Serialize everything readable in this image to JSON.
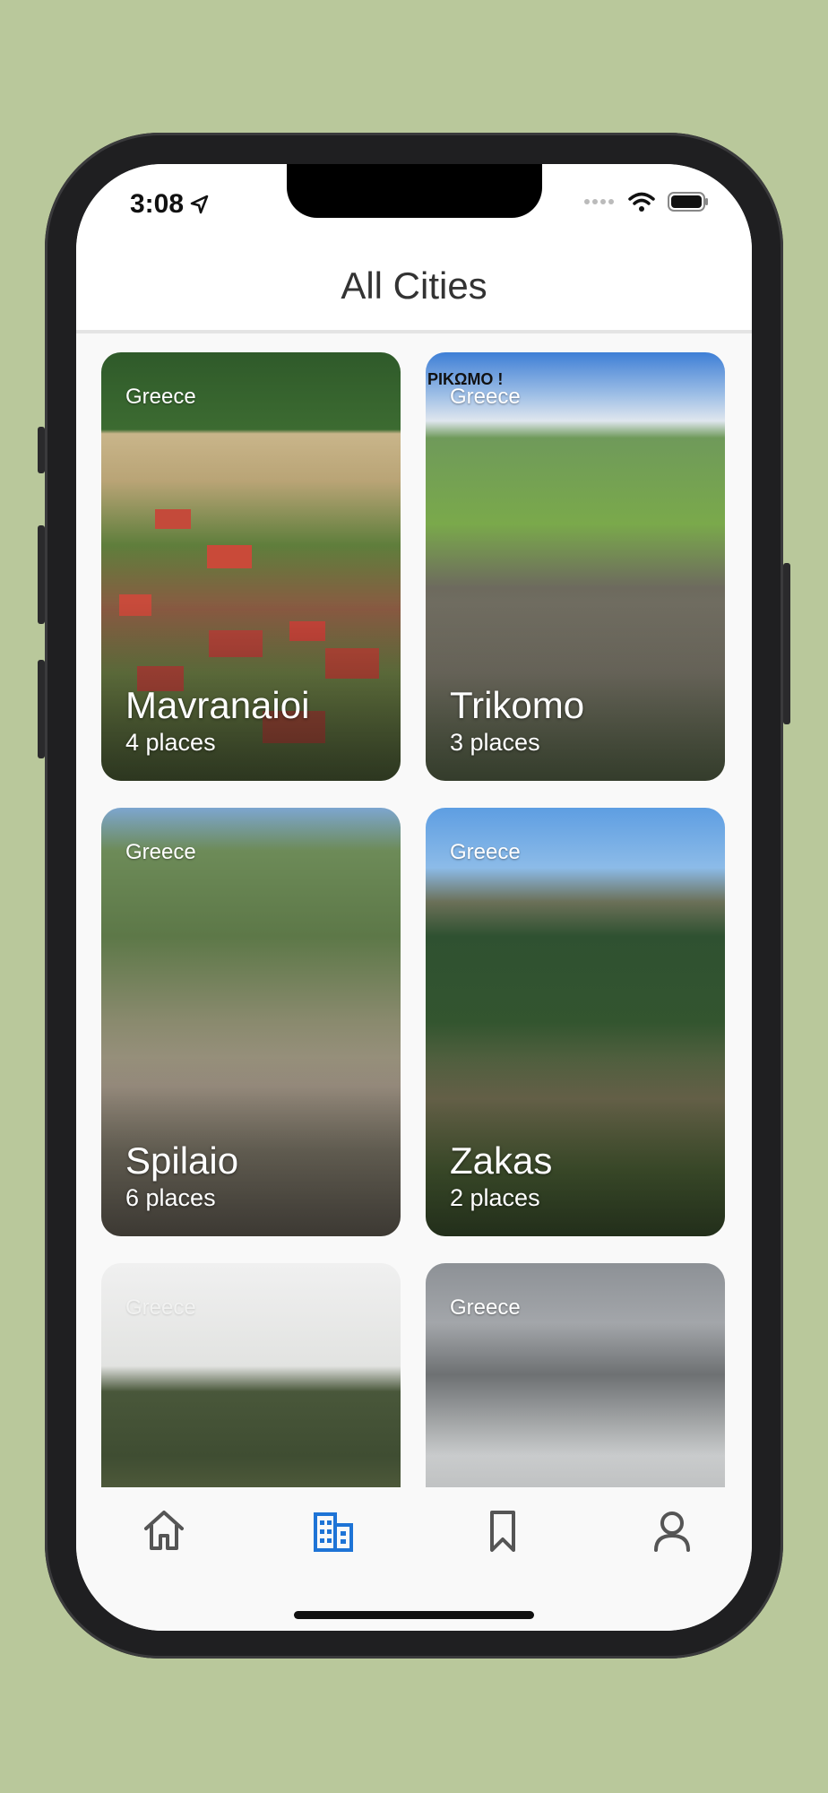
{
  "status": {
    "time": "3:08"
  },
  "header": {
    "title": "All Cities"
  },
  "cards": [
    {
      "country": "Greece",
      "name": "Mavranaioi",
      "places": "4 places"
    },
    {
      "country": "Greece",
      "name": "Trikomo",
      "places": "3 places",
      "sign": "ΡΙΚΩΜΟ !"
    },
    {
      "country": "Greece",
      "name": "Spilaio",
      "places": "6 places"
    },
    {
      "country": "Greece",
      "name": "Zakas",
      "places": "2 places"
    },
    {
      "country": "Greece",
      "name": "",
      "places": ""
    },
    {
      "country": "Greece",
      "name": "",
      "places": ""
    }
  ],
  "tabs": [
    {
      "icon": "home-icon"
    },
    {
      "icon": "city-buildings-icon",
      "active": true
    },
    {
      "icon": "bookmark-icon"
    },
    {
      "icon": "profile-icon"
    }
  ],
  "colors": {
    "background": "#b9c89b",
    "accent": "#1e74d6",
    "tab_inactive": "#555555"
  }
}
